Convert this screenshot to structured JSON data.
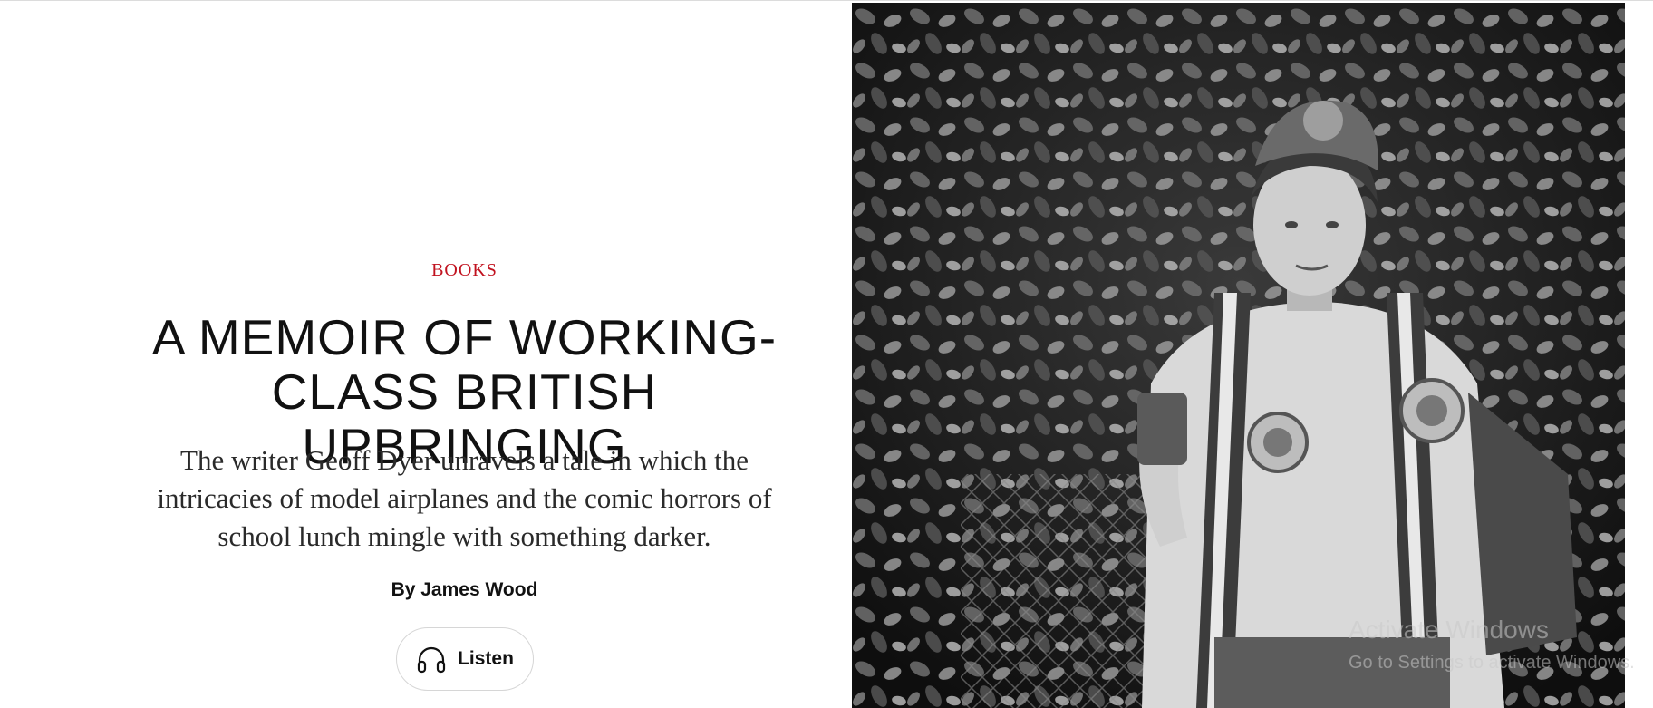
{
  "article": {
    "rubric": "BOOKS",
    "headline": "A MEMOIR OF WORKING-CLASS BRITISH UPBRINGING",
    "dek": "The writer Geoff Dyer unravels a tale in which the intricacies of model airplanes and the comic horrors of school lunch mingle with something darker.",
    "byline": "By James Wood",
    "listen_label": "Listen",
    "listen_icon": "headphones-icon"
  },
  "image": {
    "subject": "black-and-white-photo-of-boy-with-football-scarf-and-rosettes"
  },
  "os_watermark": {
    "title": "Activate Windows",
    "subtitle": "Go to Settings to activate Windows."
  },
  "colors": {
    "rubric": "#c1121f",
    "text": "#111111"
  }
}
